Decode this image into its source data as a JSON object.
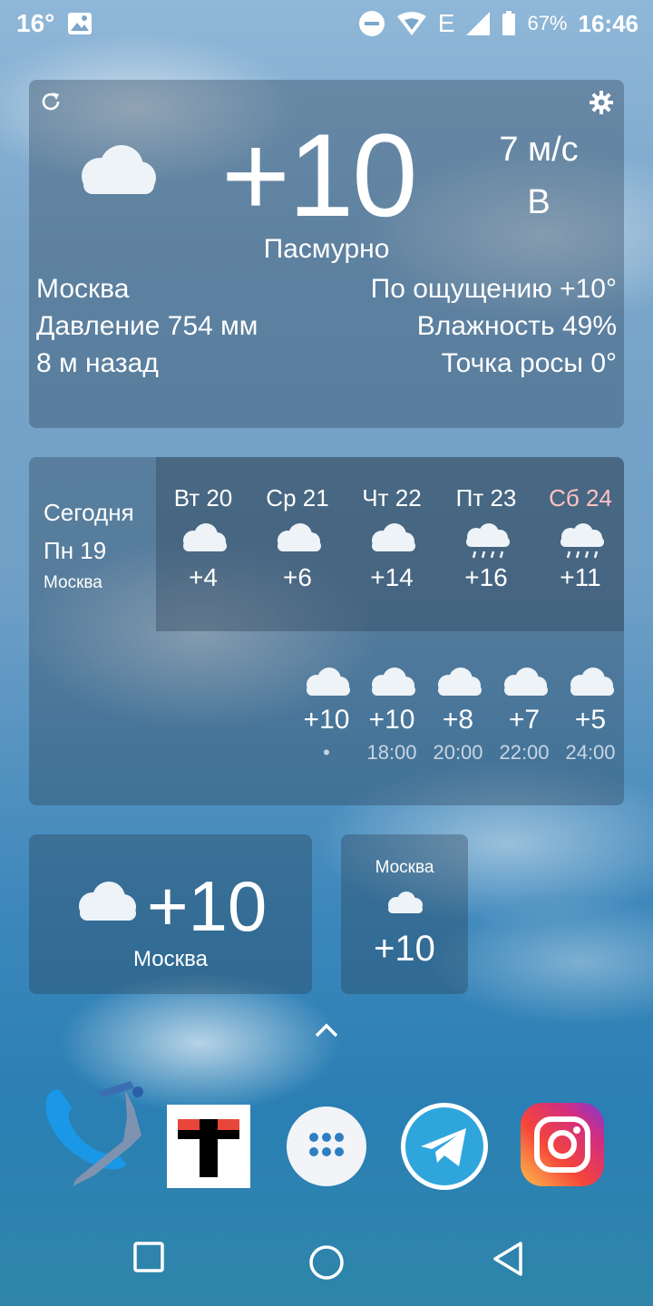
{
  "status_bar": {
    "temp": "16°",
    "battery": "67%",
    "network": "E",
    "time": "16:46"
  },
  "main_widget": {
    "temperature": "+10",
    "wind_speed": "7 м/с",
    "wind_dir": "В",
    "condition": "Пасмурно",
    "city": "Москва",
    "feels_like": "По ощущению +10°",
    "pressure": "Давление 754 мм",
    "humidity": "Влажность 49%",
    "updated": "8 м назад",
    "dew_point": "Точка росы 0°"
  },
  "forecast_widget": {
    "today_label": "Сегодня",
    "today_date": "Пн 19",
    "city": "Москва",
    "days": [
      {
        "label": "Вт 20",
        "temp": "+4",
        "icon": "cloud",
        "weekend": false
      },
      {
        "label": "Ср 21",
        "temp": "+6",
        "icon": "cloud",
        "weekend": false
      },
      {
        "label": "Чт 22",
        "temp": "+14",
        "icon": "cloud",
        "weekend": false
      },
      {
        "label": "Пт 23",
        "temp": "+16",
        "icon": "rain",
        "weekend": false
      },
      {
        "label": "Сб 24",
        "temp": "+11",
        "icon": "rain",
        "weekend": true
      }
    ],
    "hours": [
      {
        "temp": "+10",
        "time": "•"
      },
      {
        "temp": "+10",
        "time": "18:00"
      },
      {
        "temp": "+8",
        "time": "20:00"
      },
      {
        "temp": "+7",
        "time": "22:00"
      },
      {
        "temp": "+5",
        "time": "24:00"
      }
    ]
  },
  "small_widget_1": {
    "temperature": "+10",
    "city": "Москва"
  },
  "small_widget_2": {
    "city": "Москва",
    "temperature": "+10"
  },
  "colors": {
    "weekend": "#ffc2c2",
    "panel": "rgba(40,60,80,0.35)"
  },
  "dock": {
    "apps": [
      "phone-icon",
      "tj-logo-icon",
      "app-drawer-icon",
      "telegram-icon",
      "instagram-icon"
    ],
    "tj_letter": "T"
  }
}
